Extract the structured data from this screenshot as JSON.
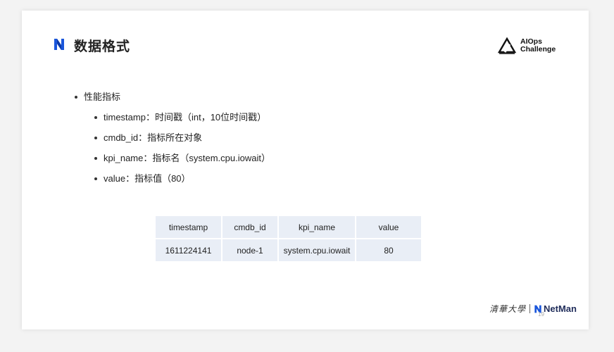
{
  "slide": {
    "title": "数据格式",
    "brand_color": "#1a56db",
    "logo_top": "AIOps",
    "logo_bottom": "Challenge"
  },
  "bullets": {
    "main": "性能指标",
    "items": [
      "timestamp：时间戳（int，10位时间戳）",
      "cmdb_id：指标所在对象",
      "kpi_name：指标名（system.cpu.iowait）",
      "value：指标值（80）"
    ]
  },
  "table": {
    "headers": [
      "timestamp",
      "cmdb_id",
      "kpi_name",
      "value"
    ],
    "rows": [
      [
        "1611224141",
        "node-1",
        "system.cpu.iowait",
        "80"
      ]
    ]
  },
  "footer": {
    "university": "清華大學",
    "lab": "NetMan",
    "page_number": "19"
  }
}
